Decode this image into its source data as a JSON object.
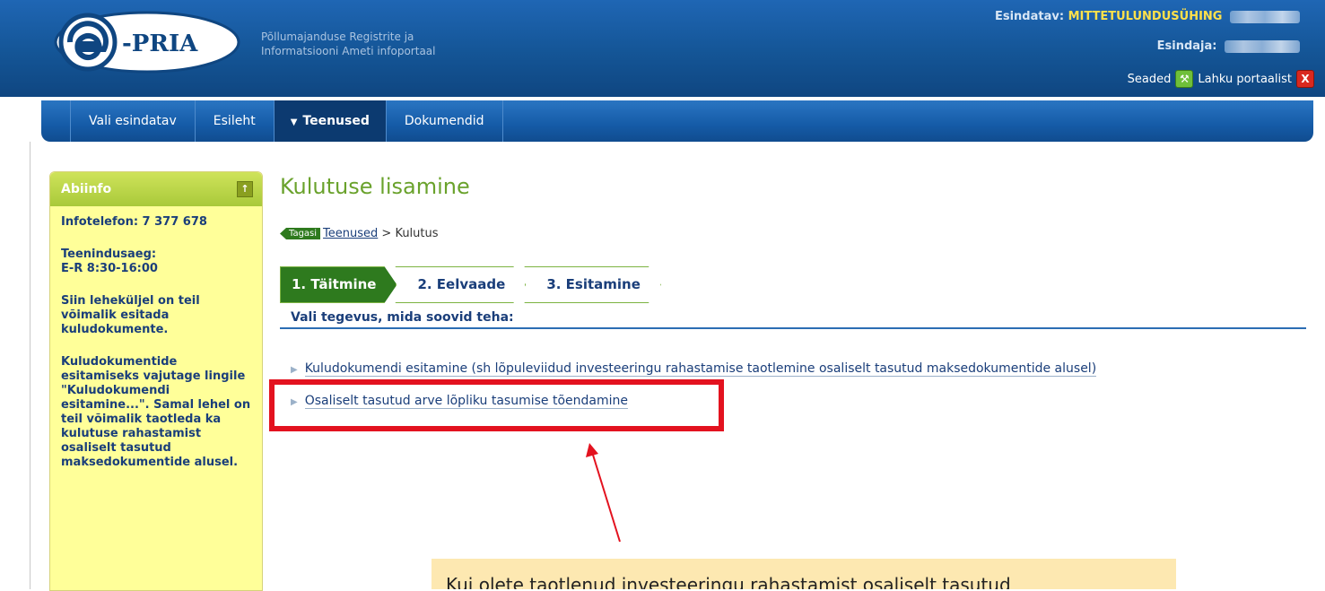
{
  "header": {
    "logo_text": "-PRIA",
    "tagline_line1": "Põllumajanduse Registrite ja",
    "tagline_line2": "Informatsiooni Ameti infoportaal",
    "represented_label": "Esindatav:",
    "represented_value": "MITTETULUNDUSÜHING",
    "representative_label": "Esindaja:",
    "settings_label": "Seaded",
    "leave_label": "Lahku portaalist",
    "colors": {
      "header_blue": "#145596",
      "org_yellow": "#ffe14a"
    }
  },
  "nav": {
    "items": [
      {
        "label": "Vali esindatav"
      },
      {
        "label": "Esileht"
      },
      {
        "label": "Teenused",
        "active": true
      },
      {
        "label": "Dokumendid"
      }
    ]
  },
  "sidebar": {
    "title": "Abiinfo",
    "phone": "Infotelefon: 7 377 678",
    "hours_label": "Teenindusaeg:",
    "hours_value": "E-R 8:30-16:00",
    "text1": "Siin leheküljel on teil võimalik esitada kuludokumente.",
    "text2": "Kuludokumentide esitamiseks vajutage lingile \"Kuludokumendi esitamine...\". Samal lehel on teil võimalik taotleda ka kulutuse rahastamist osaliselt tasutud maksedokumentide alusel.",
    "collapse_icon": "collapse-up-icon"
  },
  "main": {
    "title": "Kulutuse lisamine",
    "back_label": "Tagasi",
    "breadcrumb_link": "Teenused",
    "breadcrumb_rest": " > Kulutus",
    "steps": [
      {
        "label": "1. Täitmine"
      },
      {
        "label": "2. Eelvaade"
      },
      {
        "label": "3. Esitamine"
      }
    ],
    "subheading": "Vali tegevus, mida soovid teha:",
    "links": [
      {
        "label": "Kuludokumendi esitamine (sh lõpuleviidud investeeringu rahastamise taotlemine osaliselt tasutud maksedokumentide alusel)"
      },
      {
        "label": "Osaliselt tasutud arve lõpliku tasumise tõendamine"
      }
    ]
  },
  "annotation": {
    "text": "Kui olete taotlenud investeeringu rahastamist osaliselt tasutud",
    "highlight_color": "#e3121f"
  }
}
